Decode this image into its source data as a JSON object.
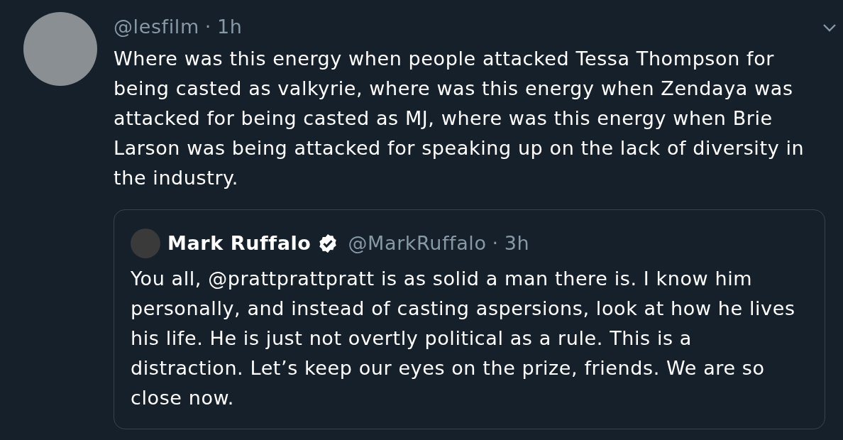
{
  "tweet": {
    "handle": "@lesfilm",
    "separator": "·",
    "time": "1h",
    "text": "Where was this energy when people attacked Tessa Thompson for being casted as valkyrie, where was this energy when Zendaya was attacked for being casted as MJ, where was this energy when Brie Larson was being attacked for speaking up on the lack of diversity in the industry.",
    "quote": {
      "name": "Mark Ruffalo",
      "verified": true,
      "handle": "@MarkRuffalo",
      "separator": "·",
      "time": "3h",
      "text": "You all, @prattprattpratt is as solid a man there is. I know him personally, and instead of casting aspersions, look at how he lives his life. He is just not overtly political as a rule. This is a distraction. Let’s keep our eyes on the prize, friends. We are so close now."
    }
  }
}
